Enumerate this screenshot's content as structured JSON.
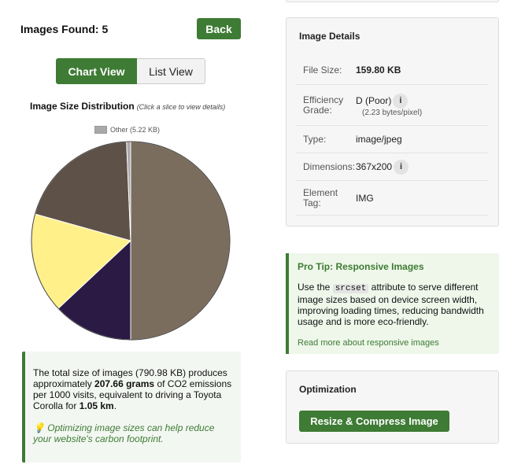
{
  "header": {
    "images_found": "Images Found: 5",
    "back_label": "Back"
  },
  "view_toggle": {
    "chart_label": "Chart View",
    "list_label": "List View"
  },
  "chart": {
    "title": "Image Size Distribution",
    "hint": "(Click a slice to view details)",
    "legend_other": "Other (5.22 KB)"
  },
  "chart_data": {
    "type": "pie",
    "title": "Image Size Distribution",
    "start_angle_deg": -90,
    "slices": [
      {
        "value": 395.49,
        "color": "#7b6d5e"
      },
      {
        "value": 103.0,
        "color": "#2a1a44"
      },
      {
        "value": 129.0,
        "color": "#fff08a"
      },
      {
        "value": 158.27,
        "color": "#5e5148"
      },
      {
        "label": "Other",
        "value": 5.22,
        "color": "#a9a9a9"
      }
    ],
    "legend_position": "top"
  },
  "info": {
    "t1": "The total size of images (790.98 KB) produces approximately ",
    "t2": "207.66 grams",
    "t3": " of CO2 emissions per 1000 visits, equivalent to driving a Toyota Corolla for ",
    "t4": "1.05 km",
    "t5": ".",
    "tip_icon": "💡",
    "tip": " Optimizing image sizes can help reduce your website's carbon footprint."
  },
  "details": {
    "title": "Image Details",
    "file_size_label": "File Size:",
    "file_size": "159.80 KB",
    "grade_label": "Efficiency Grade:",
    "grade": "D (Poor)",
    "grade_sub": "(2.23 bytes/pixel)",
    "type_label": "Type:",
    "type": "image/jpeg",
    "dims_label": "Dimensions:",
    "dims": "367x200",
    "tag_label": "Element Tag:",
    "tag": "IMG",
    "info_glyph": "i"
  },
  "pro_tip": {
    "title": "Pro Tip: Responsive Images",
    "t1": "Use the ",
    "code": "srcset",
    "t2": " attribute to serve different image sizes based on device screen width, improving loading times, reducing bandwidth usage and is more eco-friendly.",
    "link": "Read more about responsive images"
  },
  "optimization": {
    "title": "Optimization",
    "button": "Resize & Compress Image"
  },
  "colors": {
    "accent": "#3e7b34",
    "tip_bg": "#eef7ea",
    "info_bg": "#f3f7f2"
  }
}
